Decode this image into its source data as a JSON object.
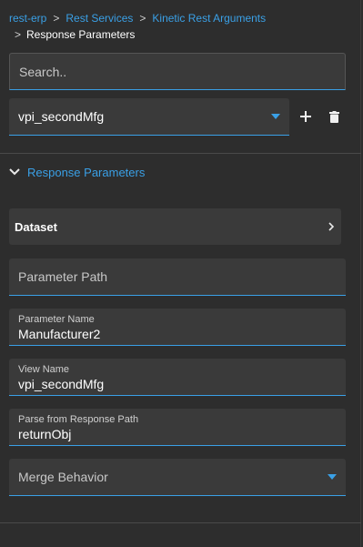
{
  "breadcrumb": {
    "items": [
      "rest-erp",
      "Rest Services",
      "Kinetic Rest Arguments"
    ],
    "separator": ">",
    "current": "Response Parameters"
  },
  "search": {
    "placeholder": "Search.."
  },
  "selector": {
    "value": "vpi_secondMfg"
  },
  "toolbar": {
    "add_icon": "plus-icon",
    "delete_icon": "trash-icon"
  },
  "section": {
    "title": "Response Parameters",
    "expanded": true
  },
  "dataset": {
    "label": "Dataset"
  },
  "fields": {
    "parameter_path": {
      "placeholder": "Parameter Path"
    },
    "parameter_name": {
      "label": "Parameter Name",
      "value": "Manufacturer2"
    },
    "view_name": {
      "label": "View Name",
      "value": "vpi_secondMfg"
    },
    "parse_path": {
      "label": "Parse from Response Path",
      "value": "returnObj"
    },
    "merge_behavior": {
      "placeholder": "Merge Behavior"
    }
  },
  "colors": {
    "accent": "#3aa0e6",
    "background": "#2d2d2d",
    "field": "#3a3a3a"
  }
}
